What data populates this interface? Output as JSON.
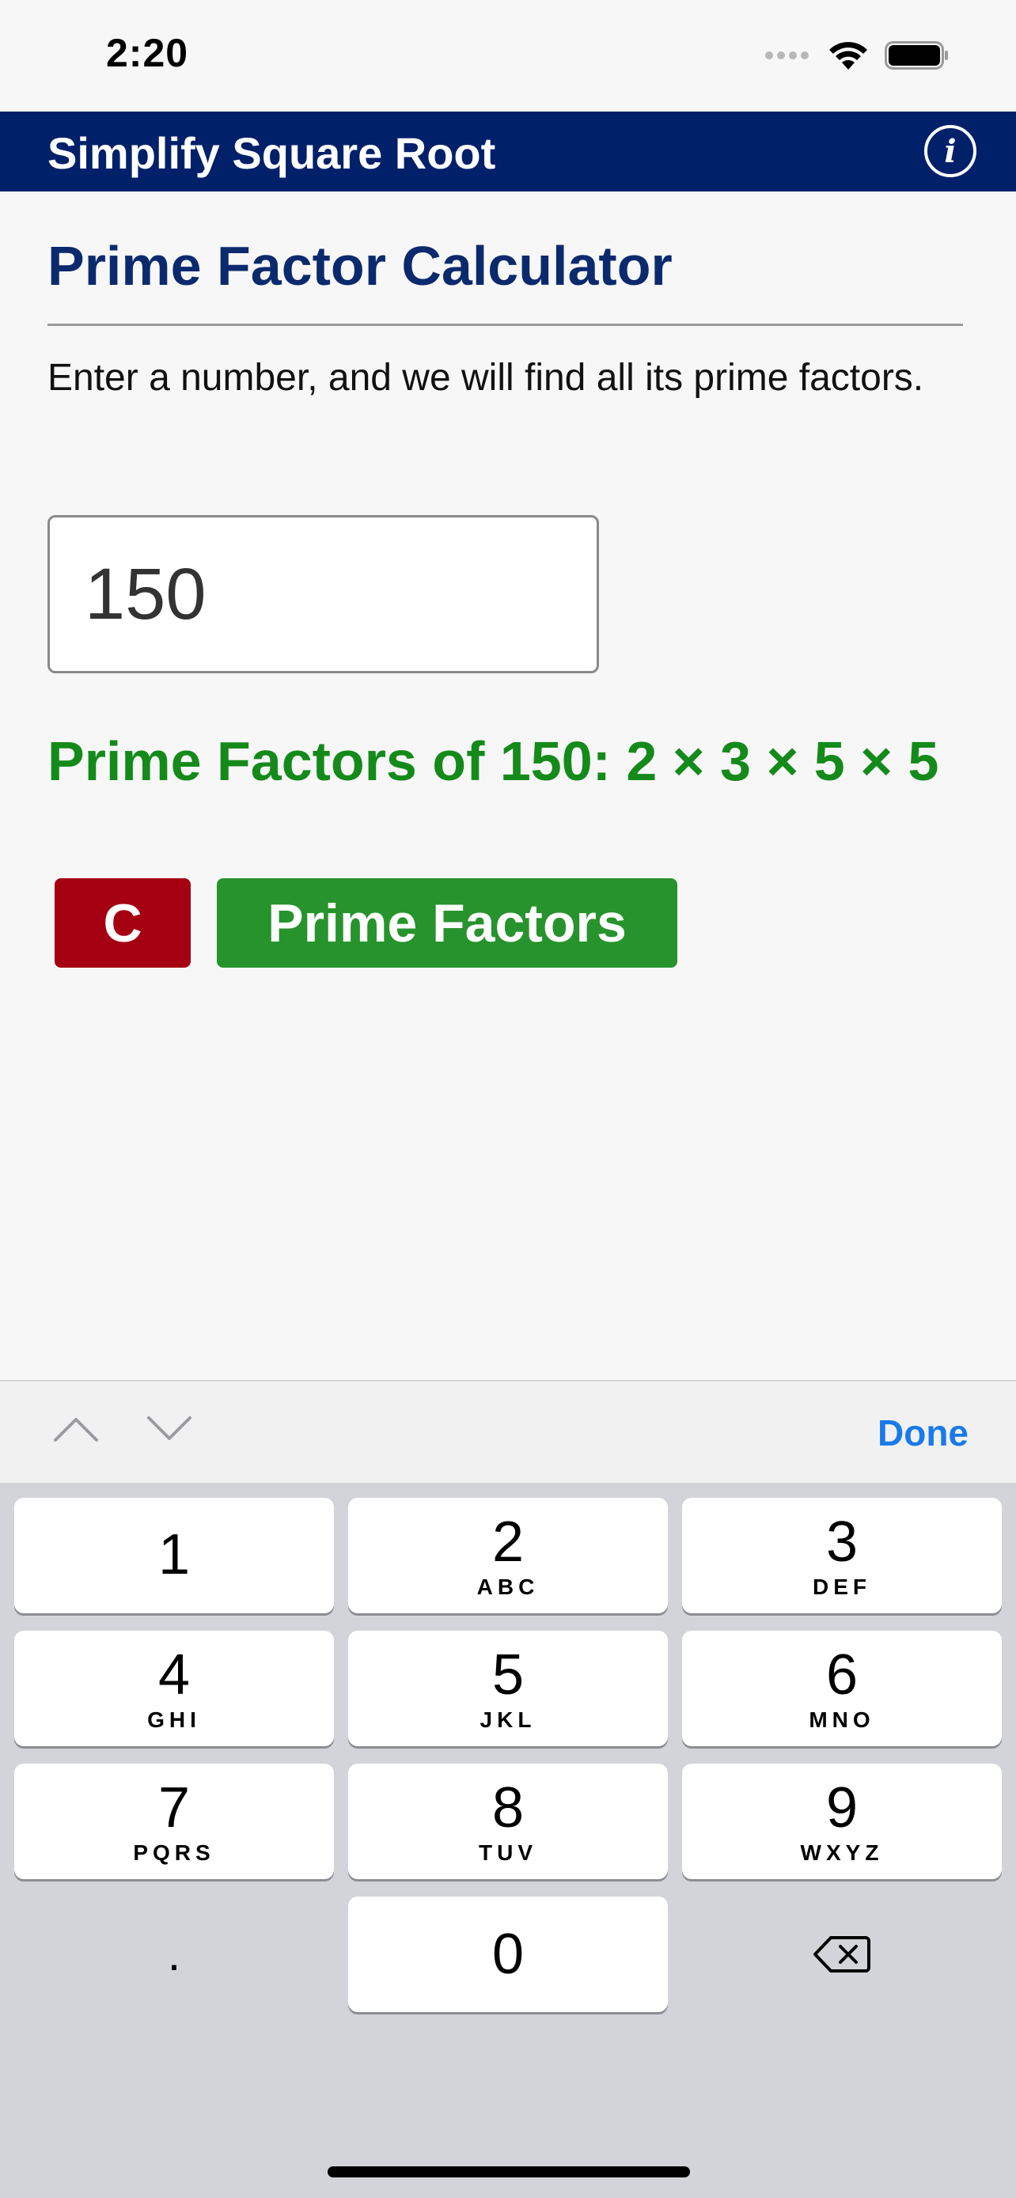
{
  "status_bar": {
    "time": "2:20"
  },
  "header": {
    "title": "Simplify Square Root",
    "info_icon": "info-icon"
  },
  "main": {
    "title": "Prime Factor Calculator",
    "description": "Enter a number, and we will find all its prime factors.",
    "input_value": "150",
    "result": "Prime Factors of 150: 2 × 3 × 5 × 5",
    "clear_label": "C",
    "factor_label": "Prime Factors"
  },
  "accessory": {
    "done_label": "Done"
  },
  "keypad": {
    "keys": [
      {
        "digit": "1",
        "letters": ""
      },
      {
        "digit": "2",
        "letters": "ABC"
      },
      {
        "digit": "3",
        "letters": "DEF"
      },
      {
        "digit": "4",
        "letters": "GHI"
      },
      {
        "digit": "5",
        "letters": "JKL"
      },
      {
        "digit": "6",
        "letters": "MNO"
      },
      {
        "digit": "7",
        "letters": "PQRS"
      },
      {
        "digit": "8",
        "letters": "TUV"
      },
      {
        "digit": "9",
        "letters": "WXYZ"
      },
      {
        "digit": ".",
        "letters": ""
      },
      {
        "digit": "0",
        "letters": ""
      }
    ]
  },
  "colors": {
    "header_bg": "#00206a",
    "title_color": "#0b2a6e",
    "result_color": "#148a1a",
    "clear_bg": "#a50011",
    "factor_bg": "#27932c",
    "done_color": "#1a7ae8"
  }
}
